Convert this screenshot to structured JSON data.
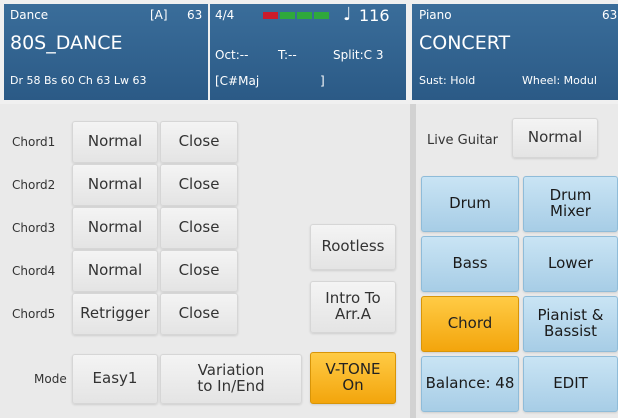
{
  "accompaniment": {
    "genre": "Dance",
    "bank": "[A]",
    "number": "63",
    "name": "80S_DANCE",
    "registers": "Dr 58  Bs 60  Ch 63  Lw 63"
  },
  "center": {
    "time_signature": "4/4",
    "meter_colors": [
      "#cc1b2b",
      "#2fa83c",
      "#2fa83c",
      "#2fa83c"
    ],
    "note_icon": "quarter-note-icon",
    "tempo": "116",
    "octave": "Oct:--",
    "transpose": "T:--",
    "split": "Split:C 3",
    "chord": "[C#Maj",
    "chord_close": "]"
  },
  "voice": {
    "category": "Piano",
    "number": "63",
    "name": "CONCERT",
    "sustain": "Sust: Hold",
    "wheel": "Wheel: Modul"
  },
  "chords": [
    {
      "label": "Chord1",
      "mode": "Normal",
      "voicing": "Close"
    },
    {
      "label": "Chord2",
      "mode": "Normal",
      "voicing": "Close"
    },
    {
      "label": "Chord3",
      "mode": "Normal",
      "voicing": "Close"
    },
    {
      "label": "Chord4",
      "mode": "Normal",
      "voicing": "Close"
    },
    {
      "label": "Chord5",
      "mode": "Retrigger",
      "voicing": "Close"
    }
  ],
  "mode_row": {
    "label": "Mode",
    "value": "Easy1",
    "variation": "Variation\nto In/End"
  },
  "options": {
    "rootless": "Rootless",
    "intro": "Intro To\nArr.A",
    "vtone": "V-TONE\nOn"
  },
  "right": {
    "live_guitar_label": "Live Guitar",
    "live_guitar_value": "Normal",
    "drum": "Drum",
    "drum_mixer": "Drum\nMixer",
    "bass": "Bass",
    "lower": "Lower",
    "chord": "Chord",
    "pianist_bassist": "Pianist &\nBassist",
    "balance": "Balance: 48",
    "edit": "EDIT"
  }
}
